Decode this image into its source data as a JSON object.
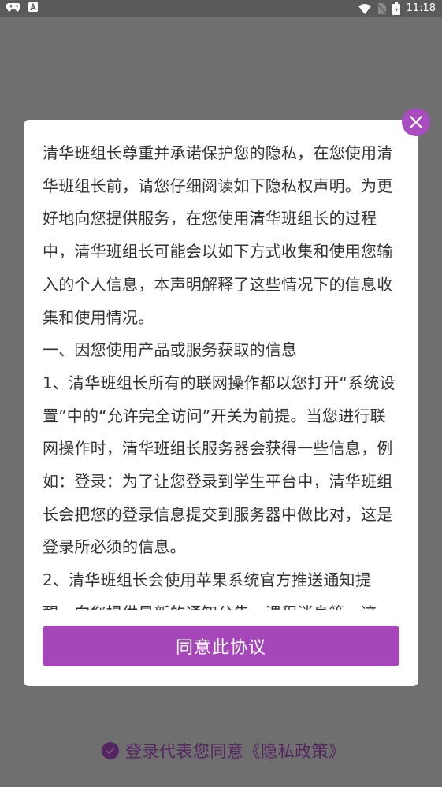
{
  "status_bar": {
    "time": "11:18",
    "left_icons": [
      "gamepad-icon",
      "app-a-icon"
    ],
    "right_icons": [
      "wifi-icon",
      "no-sim-icon",
      "battery-icon"
    ]
  },
  "modal": {
    "close_icon": "close-icon",
    "paragraphs": [
      "清华班组长尊重并承诺保护您的隐私，在您使用清华班组长前，请您仔细阅读如下隐私权声明。为更好地向您提供服务，在您使用清华班组长的过程中，清华班组长可能会以如下方式收集和使用您输入的个人信息，本声明解释了这些情况下的信息收集和使用情况。",
      "一、因您使用产品或服务获取的信息",
      "1、清华班组长所有的联网操作都以您打开“系统设置”中的“允许完全访问”开关为前提。当您进行联网操作时，清华班组长服务器会获得一些信息，例如：登录：为了让您登录到学生平台中，清华班组长会把您的登录信息提交到服务器中做比对，这是登录所必须的信息。",
      "2、清华班组长会使用苹果系统官方推送通知提醒，向您提供最新的通知公告、课程消息等，这"
    ],
    "agree_button_label": "同意此协议"
  },
  "consent": {
    "check_icon": "check-circle-icon",
    "text": "登录代表您同意《隐私政策》"
  },
  "colors": {
    "overlay": "#6f6f6f",
    "accent": "#a547b8",
    "consent": "#542560"
  }
}
